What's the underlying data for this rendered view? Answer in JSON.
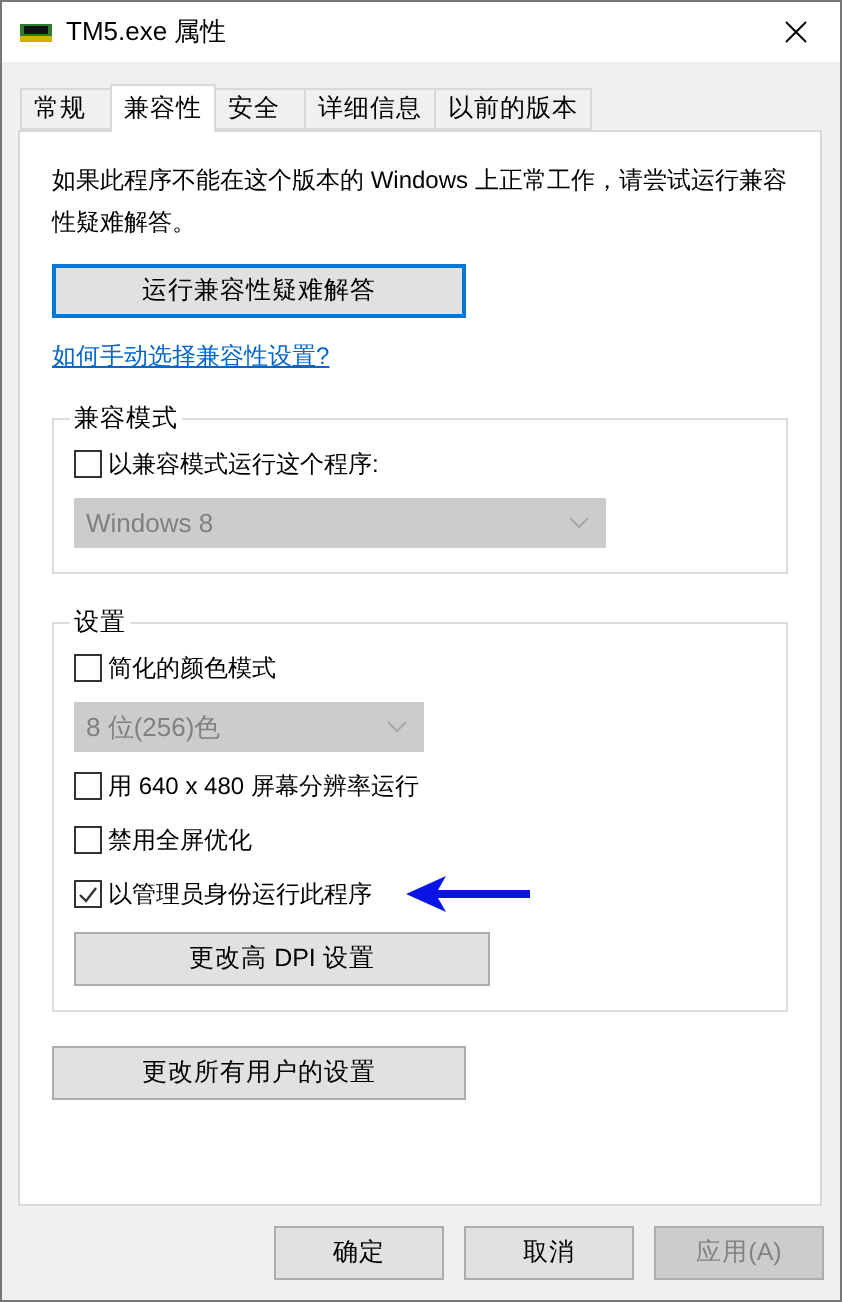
{
  "window": {
    "title": "TM5.exe 属性"
  },
  "tabs": [
    {
      "label": "常规",
      "selected": false
    },
    {
      "label": "兼容性",
      "selected": true
    },
    {
      "label": "安全",
      "selected": false
    },
    {
      "label": "详细信息",
      "selected": false
    },
    {
      "label": "以前的版本",
      "selected": false
    }
  ],
  "intro": "如果此程序不能在这个版本的 Windows 上正常工作，请尝试运行兼容性疑难解答。",
  "troubleshoot_button": "运行兼容性疑难解答",
  "help_link": "如何手动选择兼容性设置?",
  "groups": [
    {
      "title": "兼容模式",
      "items": [
        {
          "kind": "checkbox",
          "label": "以兼容模式运行这个程序:",
          "checked": false,
          "annotated": false
        },
        {
          "kind": "dropdown",
          "value": "Windows 8",
          "disabled": true,
          "wide": true
        }
      ]
    },
    {
      "title": "设置",
      "items": [
        {
          "kind": "checkbox",
          "label": "简化的颜色模式",
          "checked": false,
          "annotated": false
        },
        {
          "kind": "dropdown",
          "value": "8 位(256)色",
          "disabled": true,
          "wide": false
        },
        {
          "kind": "checkbox",
          "label": "用 640 x 480 屏幕分辨率运行",
          "checked": false,
          "annotated": false
        },
        {
          "kind": "checkbox",
          "label": "禁用全屏优化",
          "checked": false,
          "annotated": false
        },
        {
          "kind": "checkbox",
          "label": "以管理员身份运行此程序",
          "checked": true,
          "annotated": true
        },
        {
          "kind": "button",
          "label": "更改高 DPI 设置"
        }
      ]
    }
  ],
  "all_users_button": "更改所有用户的设置",
  "buttons": [
    {
      "label": "确定",
      "disabled": false
    },
    {
      "label": "取消",
      "disabled": false
    },
    {
      "label": "应用(A)",
      "disabled": true
    }
  ]
}
